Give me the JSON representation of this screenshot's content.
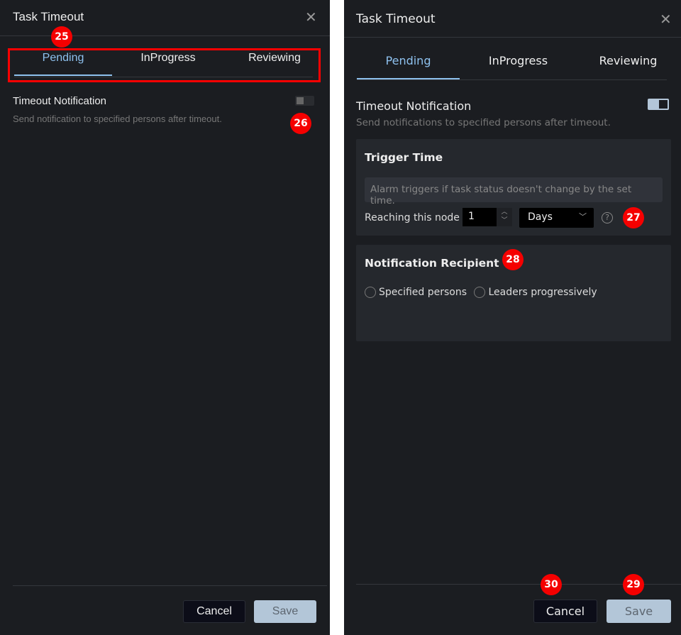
{
  "left_panel": {
    "title": "Task Timeout",
    "tabs": [
      {
        "label": "Pending",
        "active": true
      },
      {
        "label": "InProgress"
      },
      {
        "label": "Reviewing"
      }
    ],
    "notification": {
      "title": "Timeout Notification",
      "description": "Send notification to specified persons after timeout.",
      "enabled": false
    },
    "cancel_label": "Cancel",
    "save_label": "Save",
    "badges": [
      "25",
      "26"
    ]
  },
  "right_panel": {
    "title": "Task Timeout",
    "tabs": [
      {
        "label": "Pending",
        "active": true
      },
      {
        "label": "InProgress"
      },
      {
        "label": "Reviewing"
      }
    ],
    "notification": {
      "title": "Timeout Notification",
      "description": "Send notifications to specified persons after timeout.",
      "enabled": true
    },
    "trigger": {
      "title": "Trigger Time",
      "placeholder": "Alarm triggers if task status doesn't change by the set time.",
      "row_label": "Reaching this node",
      "value": "1",
      "unit": "Days"
    },
    "recipient": {
      "title": "Notification Recipient",
      "options": [
        "Specified persons",
        "Leaders progressively"
      ]
    },
    "cancel_label": "Cancel",
    "save_label": "Save",
    "badges": [
      "27",
      "28",
      "30",
      "29"
    ]
  },
  "colors": {
    "accent": "#8ec1ee",
    "badge": "#f50000",
    "panel_bg": "#1b1d21"
  }
}
